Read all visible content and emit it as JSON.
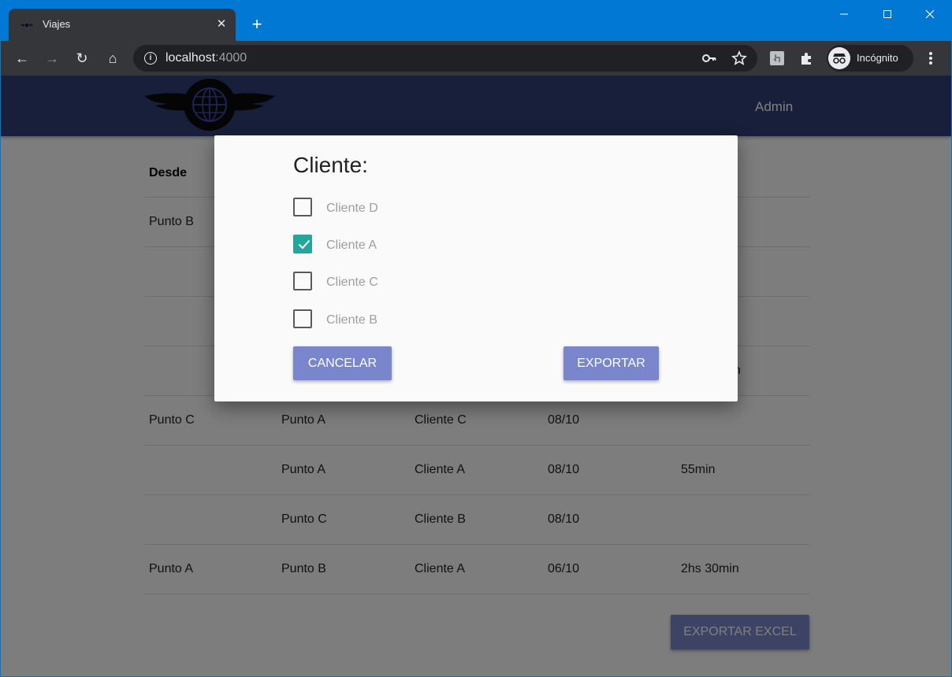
{
  "browser": {
    "tab_title": "Viajes",
    "url_host": "localhost",
    "url_port": ":4000",
    "profile_label": "Incógnito",
    "new_tab_symbol": "+",
    "close_symbol": "✕"
  },
  "window_controls": {
    "minimize": "—",
    "maximize": "☐",
    "close": "✕"
  },
  "nav": {
    "back": "←",
    "forward": "→",
    "reload": "↻",
    "home": "⌂"
  },
  "header": {
    "admin_link": "Admin"
  },
  "table": {
    "headers": [
      "Desde",
      "",
      "",
      "",
      ""
    ],
    "rows": [
      [
        "Punto B",
        "",
        "",
        "",
        ""
      ],
      [
        "",
        "",
        "",
        "",
        ""
      ],
      [
        "",
        "",
        "",
        "",
        ""
      ],
      [
        "",
        "",
        "",
        "",
        "n"
      ],
      [
        "Punto C",
        "Punto A",
        "Cliente C",
        "08/10",
        ""
      ],
      [
        "",
        "Punto A",
        "Cliente A",
        "08/10",
        "55min"
      ],
      [
        "",
        "Punto C",
        "Cliente B",
        "08/10",
        ""
      ],
      [
        "Punto A",
        "Punto B",
        "Cliente A",
        "06/10",
        "2hs 30min"
      ]
    ]
  },
  "export_excel_label": "EXPORTAR EXCEL",
  "modal": {
    "title": "Cliente:",
    "options": [
      {
        "label": "Cliente D",
        "checked": false
      },
      {
        "label": "Cliente A",
        "checked": true
      },
      {
        "label": "Cliente C",
        "checked": false
      },
      {
        "label": "Cliente B",
        "checked": false
      }
    ],
    "cancel_label": "CANCELAR",
    "export_label": "EXPORTAR"
  },
  "colors": {
    "appbar": "#303f75",
    "button": "#7986cb",
    "checkbox_checked": "#26a69a"
  }
}
